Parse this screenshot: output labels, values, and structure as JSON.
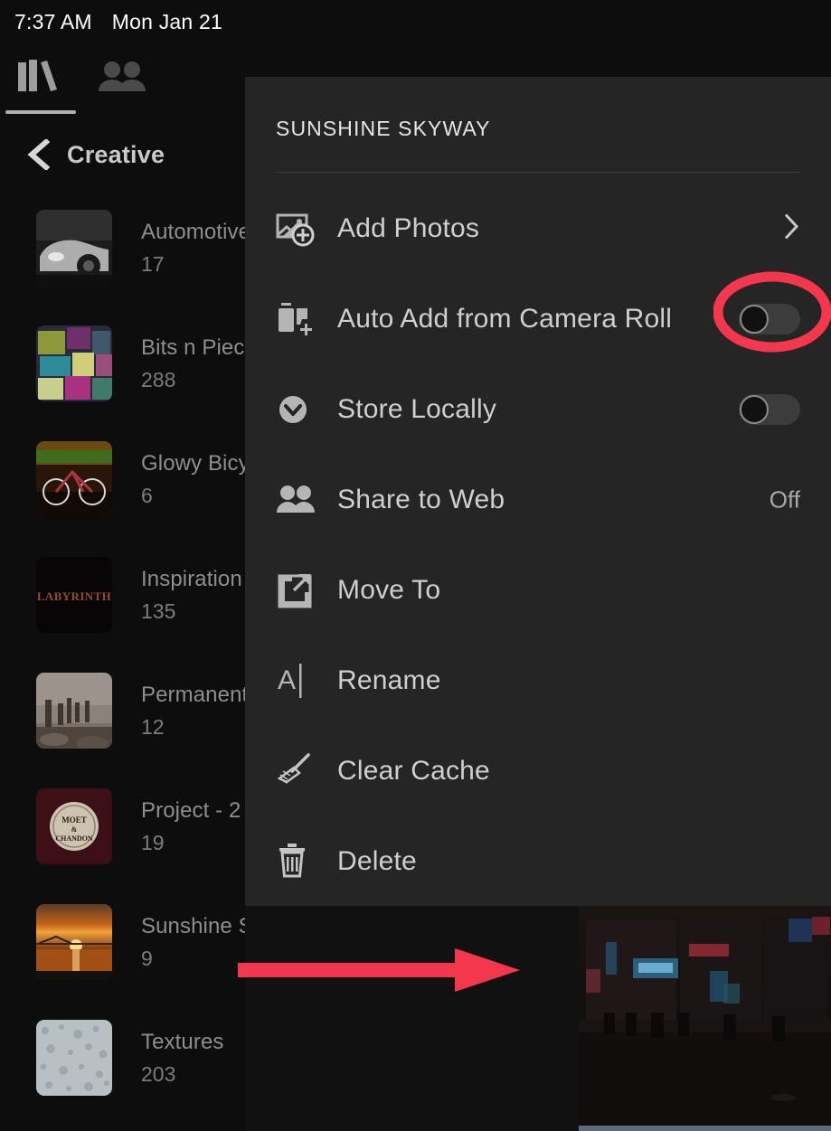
{
  "statusbar": {
    "time": "7:37 AM",
    "date": "Mon Jan 21"
  },
  "tabs": [
    {
      "name": "library",
      "icon": "library-icon",
      "active": true
    },
    {
      "name": "people",
      "icon": "people-icon",
      "active": false
    }
  ],
  "sidebar": {
    "back_icon": "back-chevron-icon",
    "title": "Creative",
    "albums": [
      {
        "name": "Automotive",
        "count": "17",
        "thumb": "car-photo",
        "dots": false
      },
      {
        "name": "Bits n Pieces",
        "count": "288",
        "thumb": "vegetables-photo",
        "dots": false
      },
      {
        "name": "Glowy Bicycle",
        "count": "6",
        "thumb": "bicycle-photo",
        "dots": false
      },
      {
        "name": "Inspiration",
        "count": "135",
        "thumb": "labyrinth-photo",
        "dots": false
      },
      {
        "name": "Permanent",
        "count": "12",
        "thumb": "pier-photo",
        "dots": false
      },
      {
        "name": "Project - 2",
        "count": "19",
        "thumb": "bottlecap-photo",
        "dots": false
      },
      {
        "name": "Sunshine Skyway",
        "count": "9",
        "thumb": "sunset-bridge-photo",
        "dots": true
      },
      {
        "name": "Textures",
        "count": "203",
        "thumb": "texture-photo",
        "dots": true
      }
    ]
  },
  "menu": {
    "title": "SUNSHINE SKYWAY",
    "items": [
      {
        "label": "Add Photos",
        "icon": "add-photos-icon",
        "right_type": "chevron",
        "value": ""
      },
      {
        "label": "Auto Add from Camera Roll",
        "icon": "camera-roll-add-icon",
        "right_type": "toggle",
        "value": "off"
      },
      {
        "label": "Store Locally",
        "icon": "download-circle-icon",
        "right_type": "toggle",
        "value": "off"
      },
      {
        "label": "Share to Web",
        "icon": "people-icon",
        "right_type": "value",
        "value": "Off"
      },
      {
        "label": "Move To",
        "icon": "move-to-icon",
        "right_type": "none",
        "value": ""
      },
      {
        "label": "Rename",
        "icon": "rename-cursor-icon",
        "right_type": "none",
        "value": ""
      },
      {
        "label": "Clear Cache",
        "icon": "broom-icon",
        "right_type": "none",
        "value": ""
      },
      {
        "label": "Delete",
        "icon": "trash-icon",
        "right_type": "none",
        "value": ""
      }
    ]
  },
  "annotations": {
    "ellipse": {
      "name": "highlight-ellipse",
      "target": "auto-add-toggle"
    },
    "arrow": {
      "name": "pointer-arrow",
      "target": "sunshine-skyway-more-options"
    },
    "color": "#F5374E"
  },
  "colors": {
    "menu_bg": "#252525",
    "app_bg": "#0d0d0d",
    "text_primary": "#cfcfcf",
    "text_muted": "#8e8e8e",
    "accent_red": "#F5374E"
  }
}
